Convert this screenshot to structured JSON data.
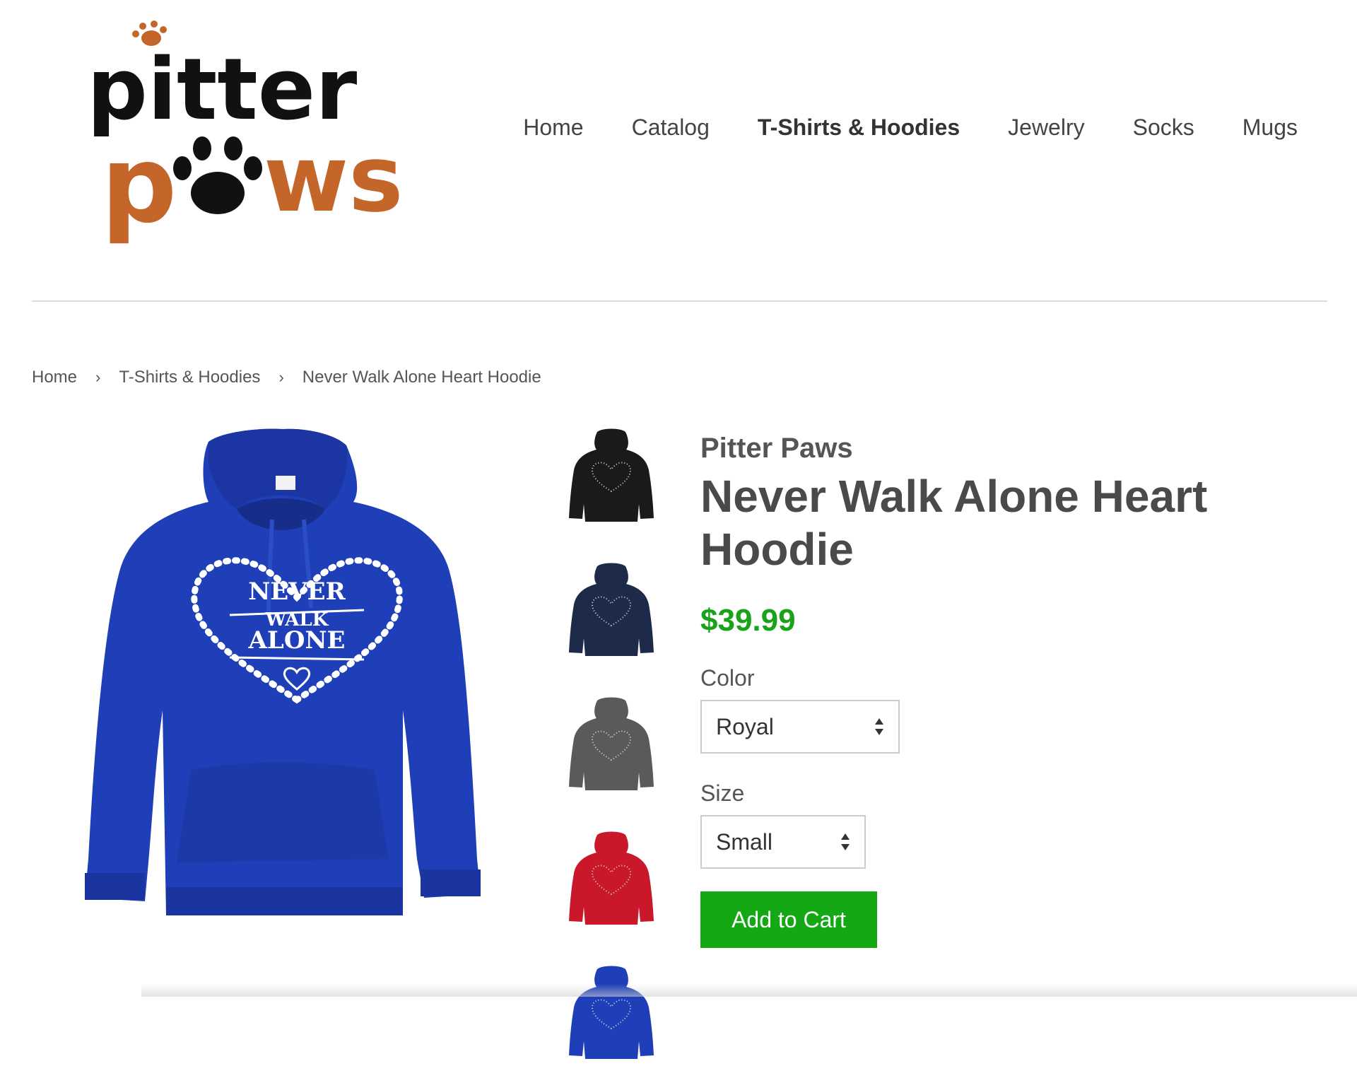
{
  "brand": {
    "logo_top_word": "pitter",
    "logo_bottom_word": "paws",
    "colors": {
      "black": "#111111",
      "orange": "#c4662a"
    }
  },
  "nav": {
    "items": [
      {
        "label": "Home"
      },
      {
        "label": "Catalog"
      },
      {
        "label": "T-Shirts & Hoodies"
      },
      {
        "label": "Jewelry"
      },
      {
        "label": "Socks"
      },
      {
        "label": "Mugs"
      }
    ],
    "active_index": 2
  },
  "breadcrumb": {
    "items": [
      "Home",
      "T-Shirts & Hoodies",
      "Never Walk Alone Heart Hoodie"
    ],
    "separator": "›"
  },
  "product": {
    "vendor": "Pitter Paws",
    "title": "Never Walk Alone Heart Hoodie",
    "price": "$39.99",
    "main_image": {
      "color": "#1f3fb8",
      "print_text": [
        "NEVER",
        "WALK",
        "ALONE"
      ]
    },
    "thumbnails": [
      {
        "name": "black",
        "color": "#1a1a1a"
      },
      {
        "name": "navy",
        "color": "#1e2a4a"
      },
      {
        "name": "charcoal",
        "color": "#5a5a5a"
      },
      {
        "name": "red",
        "color": "#c8182a"
      },
      {
        "name": "royal",
        "color": "#1f3fb8"
      }
    ],
    "options": {
      "color_label": "Color",
      "color_value": "Royal",
      "size_label": "Size",
      "size_value": "Small"
    },
    "add_to_cart_label": "Add to Cart",
    "price_color": "#1aa31a",
    "button_color": "#14a814"
  }
}
